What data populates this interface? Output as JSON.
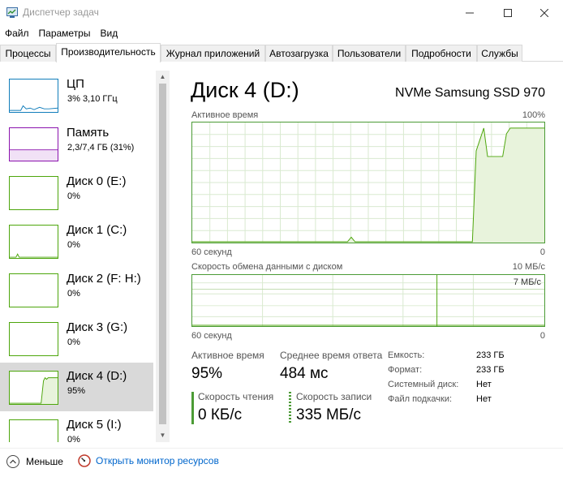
{
  "window": {
    "title": "Диспетчер задач",
    "minimize_icon": "minimize-icon",
    "maximize_icon": "maximize-icon",
    "close_icon": "close-icon"
  },
  "menu": [
    "Файл",
    "Параметры",
    "Вид"
  ],
  "tabs": [
    "Процессы",
    "Производительность",
    "Журнал приложений",
    "Автозагрузка",
    "Пользователи",
    "Подробности",
    "Службы"
  ],
  "active_tab": "Производительность",
  "sidebar": {
    "items": [
      {
        "name": "ЦП",
        "value": "3%  3,10 ГГц",
        "color": "#117dbb"
      },
      {
        "name": "Память",
        "value": "2,3/7,4 ГБ (31%)",
        "color": "#8b12ae"
      },
      {
        "name": "Диск 0 (E:)",
        "value": "0%",
        "color": "#4da60c"
      },
      {
        "name": "Диск 1 (C:)",
        "value": "0%",
        "color": "#4da60c"
      },
      {
        "name": "Диск 2 (F: H:)",
        "value": "0%",
        "color": "#4da60c"
      },
      {
        "name": "Диск 3 (G:)",
        "value": "0%",
        "color": "#4da60c"
      },
      {
        "name": "Диск 4 (D:)",
        "value": "95%",
        "color": "#4da60c"
      },
      {
        "name": "Диск 5 (I:)",
        "value": "0%",
        "color": "#4da60c"
      }
    ],
    "selected_index": 6
  },
  "main": {
    "title": "Диск 4 (D:)",
    "device": "NVMe Samsung SSD 970",
    "active_graph": {
      "label": "Активное время",
      "max": "100%",
      "x_left": "60 секунд",
      "x_right": "0"
    },
    "transfer_graph": {
      "label": "Скорость обмена данными с диском",
      "max": "10 МБ/с",
      "inner_label": "7 МБ/с",
      "x_left": "60 секунд",
      "x_right": "0"
    },
    "stats": {
      "active_time_label": "Активное время",
      "active_time_value": "95%",
      "response_label": "Среднее время ответа",
      "response_value": "484 мс",
      "read_label": "Скорость чтения",
      "read_value": "0 КБ/с",
      "write_label": "Скорость записи",
      "write_value": "335 МБ/с"
    },
    "properties": [
      {
        "label": "Емкость:",
        "value": "233 ГБ"
      },
      {
        "label": "Формат:",
        "value": "233 ГБ"
      },
      {
        "label": "Системный диск:",
        "value": "Нет"
      },
      {
        "label": "Файл подкачки:",
        "value": "Нет"
      }
    ]
  },
  "footer": {
    "fewer_label": "Меньше",
    "resmon_link": "Открыть монитор ресурсов"
  },
  "chart_data": {
    "type": "area",
    "title": "Активное время",
    "xlabel": "",
    "ylabel": "",
    "x_range": [
      "60 секунд",
      "0"
    ],
    "ylim": [
      0,
      100
    ],
    "grid": true,
    "series": [
      {
        "values": [
          0,
          0,
          0,
          0,
          0,
          0,
          0,
          0,
          0,
          0,
          0,
          0,
          0,
          0,
          0,
          0,
          0,
          0,
          0,
          0,
          0,
          0,
          0,
          0,
          0,
          0,
          0,
          0,
          0,
          0,
          0,
          0,
          0,
          0,
          0,
          0,
          0,
          0,
          0,
          0,
          0,
          0,
          4,
          0,
          0,
          0,
          0,
          0,
          0,
          0,
          0,
          0,
          0,
          0,
          0,
          0,
          0,
          0,
          0,
          0,
          0,
          0,
          0,
          0,
          0,
          0,
          0,
          0,
          0,
          0,
          0,
          0,
          0,
          0,
          0,
          80,
          90,
          100,
          75,
          75,
          75,
          75,
          75,
          95,
          100,
          100,
          100,
          100,
          100,
          100,
          100,
          100,
          100,
          100
        ]
      }
    ]
  }
}
